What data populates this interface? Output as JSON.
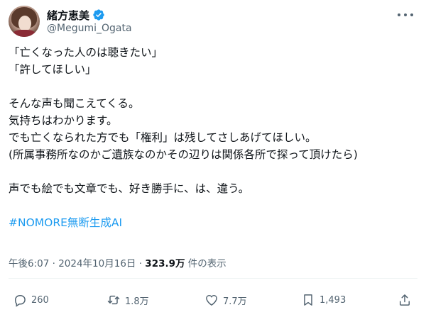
{
  "author": {
    "display_name": "緒方恵美",
    "handle": "@Megumi_Ogata",
    "verified_icon": "verified-badge-icon",
    "verified_color": "#1d9bf0"
  },
  "post": {
    "lines": [
      "「亡くなった人のは聴きたい」",
      "「許してほしい」",
      "",
      "そんな声も聞こえてくる。",
      "気持ちはわかります。",
      "でも亡くなられた方でも「権利」は残してさしあげてほしい。",
      "(所属事務所なのかご遺族なのかその辺りは関係各所で探って頂けたら)",
      "",
      "声でも絵でも文章でも、好き勝手に、は、違う。",
      ""
    ],
    "hashtag": "#NOMORE無断生成AI",
    "hashtag_color": "#1d9bf0"
  },
  "meta": {
    "time": "午後6:07",
    "separator": " · ",
    "date": "2024年10月16日",
    "separator2": " · ",
    "views": "323.9万",
    "views_suffix": " 件の表示"
  },
  "actions": {
    "replies": "260",
    "reposts": "1.8万",
    "likes": "7.7万",
    "bookmarks": "1,493"
  }
}
